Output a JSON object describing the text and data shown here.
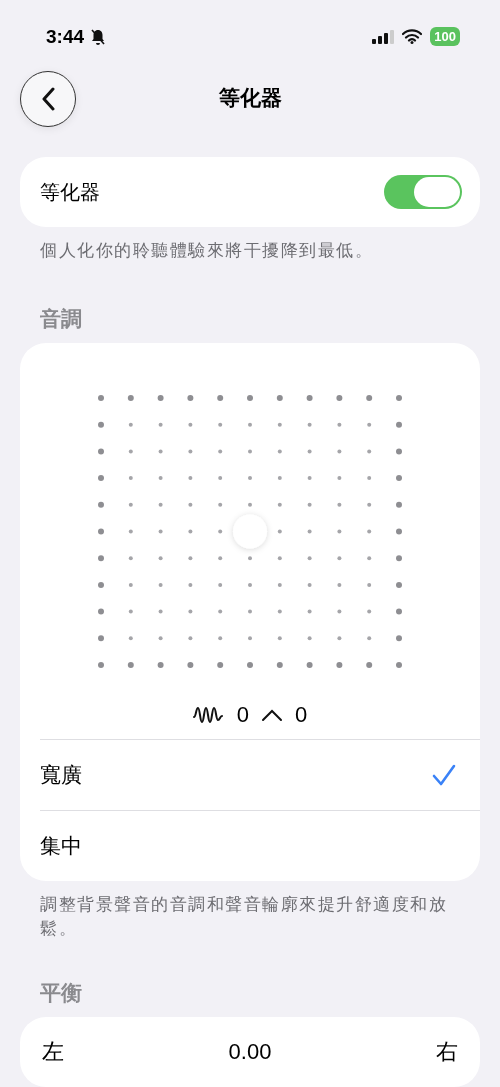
{
  "status_bar": {
    "time": "3:44",
    "battery": "100"
  },
  "nav": {
    "title": "等化器"
  },
  "equalizer": {
    "label": "等化器",
    "on": true,
    "caption": "個人化你的聆聽體驗來將干擾降到最低。"
  },
  "tone": {
    "header": "音調",
    "readout_1": "0",
    "readout_2": "0",
    "options": [
      {
        "label": "寬廣",
        "selected": true
      },
      {
        "label": "集中",
        "selected": false
      }
    ],
    "caption": "調整背景聲音的音調和聲音輪廓來提升舒適度和放鬆。"
  },
  "balance": {
    "header": "平衡",
    "left": "左",
    "value": "0.00",
    "right": "右"
  }
}
